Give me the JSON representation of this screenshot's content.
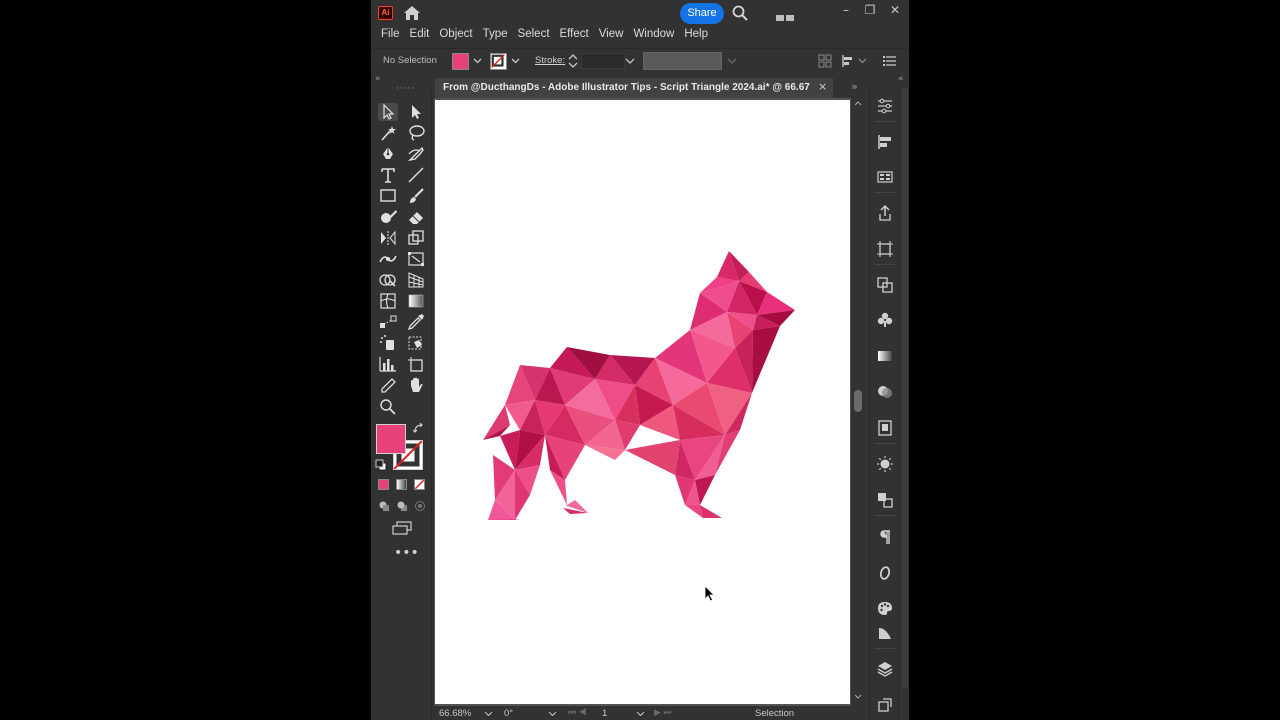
{
  "app": {
    "logo_text": "Ai",
    "share_label": "Share"
  },
  "menu": [
    "File",
    "Edit",
    "Object",
    "Type",
    "Select",
    "Effect",
    "View",
    "Window",
    "Help"
  ],
  "control_bar": {
    "selection_status": "No Selection",
    "stroke_label": "Stroke:",
    "fill_color": "#e8407a"
  },
  "document": {
    "tab_title": "From @DucthangDs - Adobe Illustrator Tips - Script Triangle 2024.ai* @ 66.67 ...",
    "close_symbol": "×"
  },
  "statusbar": {
    "zoom": "66.68%",
    "angle": "0°",
    "page": "1",
    "current_tool": "Selection"
  },
  "colors": {
    "accent": "#1473e6",
    "fill": "#e8407a",
    "ui_dark": "#323232"
  }
}
